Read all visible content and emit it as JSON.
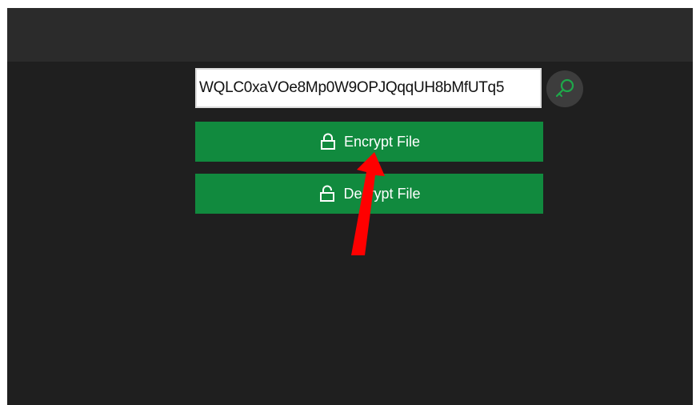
{
  "key_field": {
    "value": "WQLC0xaVOe8Mp0W9OPJQqqUH8bMfUTq5"
  },
  "icons": {
    "key_button": "key-icon",
    "encrypt": "lock-closed-icon",
    "decrypt": "lock-open-icon",
    "annotation": "red-arrow"
  },
  "buttons": {
    "encrypt_label": "Encrypt File",
    "decrypt_label": "Decrypt File"
  },
  "colors": {
    "window_bg": "#1f1f1f",
    "titlebar_bg": "#2b2b2b",
    "button_green": "#118a3e",
    "key_icon_green": "#1ea84a",
    "arrow_red": "#ff0000"
  }
}
